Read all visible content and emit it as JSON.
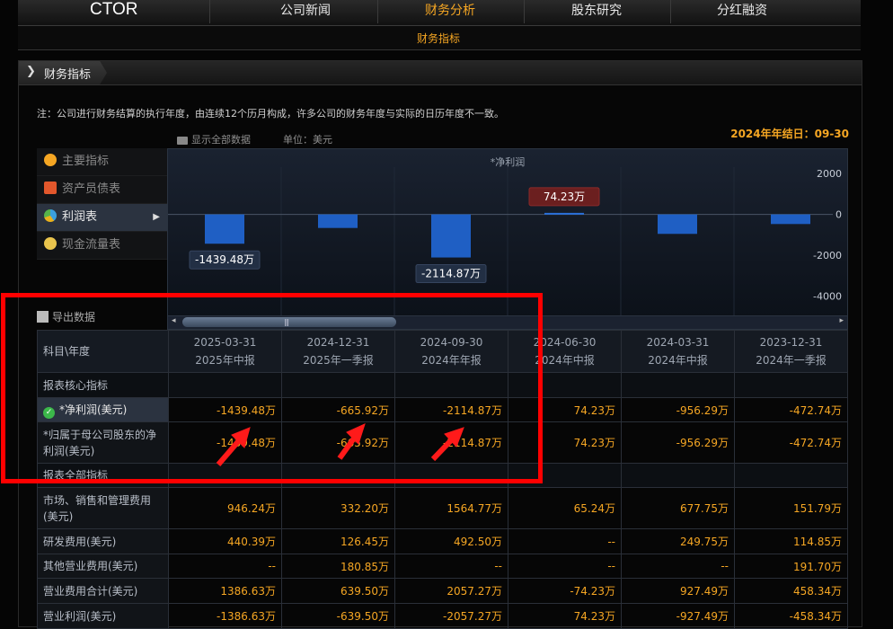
{
  "topnav": {
    "logo": "CTOR",
    "items": [
      {
        "label": "公司新闻",
        "active": false
      },
      {
        "label": "财务分析",
        "active": true
      },
      {
        "label": "股东研究",
        "active": false
      },
      {
        "label": "分红融资",
        "active": false
      }
    ]
  },
  "subnav": {
    "active_label": "财务指标"
  },
  "panel": {
    "title": "财务指标",
    "note": "注：公司进行财务结算的执行年度，由连续12个历月构成，许多公司的财务年度与实际的日历年度不一致。",
    "fiscal_year_end": "2024年年结日：09-30",
    "show_all": "显示全部数据",
    "unit": "单位：美元",
    "export": "导出数据"
  },
  "left_menu": [
    {
      "label": "主要指标",
      "icon": "sun-icon",
      "active": false
    },
    {
      "label": "资产员债表",
      "icon": "document-icon",
      "active": false
    },
    {
      "label": "利润表",
      "icon": "pie-chart-icon",
      "active": true
    },
    {
      "label": "现金流量表",
      "icon": "coins-icon",
      "active": false
    }
  ],
  "chart_data": {
    "type": "bar",
    "title": "*净利润",
    "categories": [
      "2025-03-31",
      "2024-12-31",
      "2024-09-30",
      "2024-06-30",
      "2024-03-31",
      "2023-12-31"
    ],
    "values": [
      -1439.48,
      -665.92,
      -2114.87,
      74.23,
      -956.29,
      -472.74
    ],
    "ylim": [
      -5000,
      3200
    ],
    "yticks": [
      2000,
      0,
      -2000,
      -4000
    ],
    "data_labels": [
      {
        "index": 0,
        "text": "-1439.48万"
      },
      {
        "index": 2,
        "text": "-2114.87万"
      },
      {
        "index": 3,
        "text": "74.23万"
      }
    ]
  },
  "table": {
    "header_first": "科目\\年度",
    "columns": [
      {
        "date": "2025-03-31",
        "period": "2025年中报"
      },
      {
        "date": "2024-12-31",
        "period": "2025年一季报"
      },
      {
        "date": "2024-09-30",
        "period": "2024年年报"
      },
      {
        "date": "2024-06-30",
        "period": "2024年中报"
      },
      {
        "date": "2024-03-31",
        "period": "2024年中报"
      },
      {
        "date": "2023-12-31",
        "period": "2024年一季报"
      }
    ],
    "rows": [
      {
        "label": "报表核心指标",
        "section": true,
        "values": [
          "",
          "",
          "",
          "",
          "",
          ""
        ]
      },
      {
        "label": "*净利润(美元)",
        "highlight": true,
        "values": [
          "-1439.48万",
          "-665.92万",
          "-2114.87万",
          "74.23万",
          "-956.29万",
          "-472.74万"
        ]
      },
      {
        "label": "*归属于母公司股东的净利润(美元)",
        "values": [
          "-1439.48万",
          "-665.92万",
          "-2114.87万",
          "74.23万",
          "-956.29万",
          "-472.74万"
        ]
      },
      {
        "label": "报表全部指标",
        "section": true,
        "values": [
          "",
          "",
          "",
          "",
          "",
          ""
        ]
      },
      {
        "label": "市场、销售和管理费用(美元)",
        "values": [
          "946.24万",
          "332.20万",
          "1564.77万",
          "65.24万",
          "677.75万",
          "151.79万"
        ]
      },
      {
        "label": "研发费用(美元)",
        "values": [
          "440.39万",
          "126.45万",
          "492.50万",
          "--",
          "249.75万",
          "114.85万"
        ]
      },
      {
        "label": "其他营业费用(美元)",
        "values": [
          "--",
          "180.85万",
          "--",
          "--",
          "--",
          "191.70万"
        ]
      },
      {
        "label": "营业费用合计(美元)",
        "values": [
          "1386.63万",
          "639.50万",
          "2057.27万",
          "-74.23万",
          "927.49万",
          "458.34万"
        ]
      },
      {
        "label": "营业利润(美元)",
        "values": [
          "-1386.63万",
          "-639.50万",
          "-2057.27万",
          "74.23万",
          "-927.49万",
          "-458.34万"
        ]
      }
    ]
  },
  "colors": {
    "accent": "#f5a623",
    "annotation": "#ff0000",
    "bar": "#1f5fc4"
  }
}
